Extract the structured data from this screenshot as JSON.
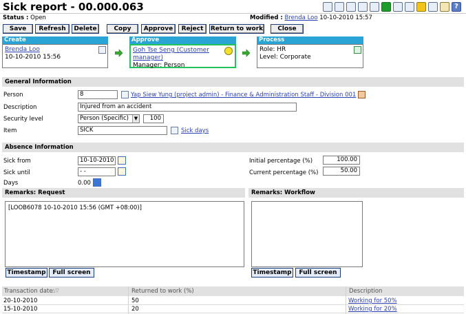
{
  "header": {
    "title": "Sick report - 00.000.063",
    "status_label": "Status :",
    "status_value": "Open",
    "modified_label": "Modified :",
    "modified_by": "Brenda Loo",
    "modified_date": "10-10-2010 15:57"
  },
  "toolbar_icons": [
    "grid-icon",
    "document-icon",
    "document-icon",
    "document-icon",
    "document-icon",
    "info-icon",
    "database-icon",
    "database-icon",
    "settings-icon",
    "print-icon",
    "home-icon",
    "help-icon"
  ],
  "buttons": {
    "save": "Save",
    "refresh": "Refresh",
    "delete": "Delete",
    "copy": "Copy",
    "approve": "Approve",
    "reject": "Reject",
    "return_to_work": "Return to work",
    "close": "Close"
  },
  "workflow": {
    "create": {
      "title": "Create",
      "name": "Brenda Loo",
      "date": "10-10-2010 15:56"
    },
    "approve": {
      "title": "Approve",
      "name": "Goh Tse Seng (Customer manager)",
      "manager": "Manager: Person"
    },
    "process": {
      "title": "Process",
      "role": "Role: HR",
      "level": "Level: Corporate"
    }
  },
  "general": {
    "heading": "General Information",
    "person_label": "Person",
    "person_value": "8",
    "person_link": "Yap Siew Yung (project admin) - Finance & Administration Staff - Division 001",
    "description_label": "Description",
    "description_value": "Injured from an accident",
    "security_label": "Security level",
    "security_value": "Person (Specific)",
    "security_number": "100",
    "item_label": "Item",
    "item_value": "SICK",
    "item_link": "Sick days"
  },
  "absence": {
    "heading": "Absence Information",
    "sick_from_label": "Sick from",
    "sick_from_value": "10-10-2010",
    "sick_until_label": "Sick until",
    "sick_until_value": "- -",
    "days_label": "Days",
    "days_value": "0.00",
    "initial_label": "Initial percentage (%)",
    "initial_value": "100.00",
    "current_label": "Current percentage (%)",
    "current_value": "50.00"
  },
  "remarks": {
    "request_heading": "Remarks: Request",
    "request_text": "[LOOB6078 10-10-2010 15:56 (GMT +08:00)]",
    "workflow_heading": "Remarks: Workflow",
    "workflow_text": "",
    "timestamp": "Timestamp",
    "full_screen": "Full screen"
  },
  "table": {
    "columns": [
      "Transaction date",
      "Returned to work (%)",
      "Description"
    ],
    "sort_indicator": "△▽",
    "rows": [
      {
        "date": "20-10-2010",
        "percent": "50",
        "description": "Working for 50%"
      },
      {
        "date": "15-10-2010",
        "percent": "20",
        "description": "Working for 20%"
      }
    ]
  },
  "colors": {
    "workflow_header": "#2aa3d5",
    "active_border": "#22c45a",
    "link": "#2b3fb8",
    "section_bg": "#e1e1e1"
  }
}
